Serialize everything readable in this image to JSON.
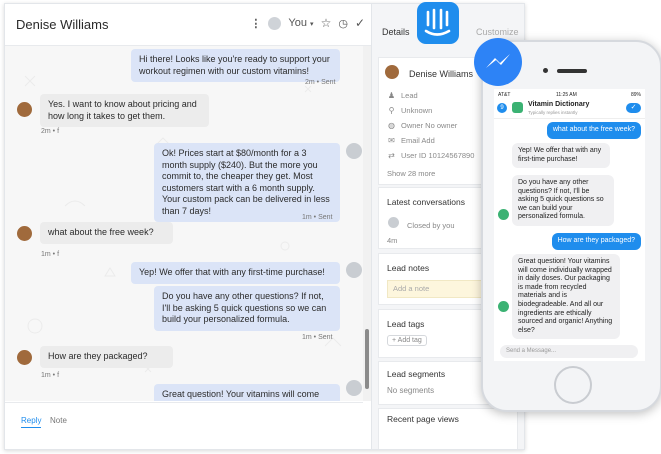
{
  "conversation": {
    "contact_name": "Denise Williams",
    "assignee": "You",
    "messages": [
      {
        "from": "admin",
        "text": "Hi there! Looks like you're ready to support your workout regimen with our custom vitamins!",
        "meta": "2m • Sent"
      },
      {
        "from": "user",
        "text": "Yes. I want to know about pricing and how long it takes to get them.",
        "meta": "2m • f"
      },
      {
        "from": "admin",
        "text": "Ok! Prices start at $80/month for a 3 month supply ($240). But the more you commit to, the cheaper they get. Most customers start with a 6 month supply. Your custom pack can be delivered in less than 7 days!",
        "meta": "1m • Sent"
      },
      {
        "from": "user",
        "text": "what about the free week?",
        "meta": "1m • f"
      },
      {
        "from": "admin",
        "text": "Yep! We offer that with any first-time purchase!"
      },
      {
        "from": "admin",
        "text": "Do you have any other questions? If not, I'll be asking 5 quick questions so we can build your personalized formula.",
        "meta": "1m • Sent"
      },
      {
        "from": "user",
        "text": "How are they packaged?",
        "meta": "1m • f"
      },
      {
        "from": "admin",
        "text": "Great question! Your vitamins will come individually wrapped in daily doses. Our"
      }
    ],
    "reply_tabs": [
      "Reply",
      "Note"
    ]
  },
  "sidebar": {
    "tabs": [
      "Details",
      "Customize"
    ],
    "contact_name": "Denise Williams",
    "fields": [
      {
        "icon": "person-icon",
        "text": "Lead"
      },
      {
        "icon": "location-icon",
        "text": "Unknown"
      },
      {
        "icon": "owner-icon",
        "text": "Owner   No owner"
      },
      {
        "icon": "email-icon",
        "text": "Email   Add"
      },
      {
        "icon": "userid-icon",
        "text": "User ID   10124567890"
      }
    ],
    "show_more": "Show 28 more",
    "latest_conversations": {
      "title": "Latest conversations",
      "status": "Closed by you",
      "time": "4m"
    },
    "lead_notes": {
      "title": "Lead notes",
      "placeholder": "Add a note"
    },
    "lead_tags": {
      "title": "Lead tags",
      "button": "+ Add tag"
    },
    "lead_segments": {
      "title": "Lead segments",
      "value": "No segments"
    },
    "recent_page_views": {
      "title": "Recent page views"
    }
  },
  "phone": {
    "status": {
      "carrier": "AT&T",
      "time": "11:25 AM",
      "battery": "89%"
    },
    "app_title": "Vitamin Dictionary",
    "app_subtitle": "Typically replies instantly",
    "back_count": "9",
    "messages": [
      {
        "side": "right",
        "text": "what about the free week?"
      },
      {
        "side": "left",
        "text": "Yep! We offer that with any first-time purchase!"
      },
      {
        "side": "left",
        "text": "Do you have any other questions? If not, I'll be asking 5 quick questions so we can build your personalized formula."
      },
      {
        "side": "right",
        "text": "How are they packaged?"
      },
      {
        "side": "left",
        "text": "Great question! Your vitamins will come individually wrapped in daily doses. Our packaging is made from recycled materials and is biodegradeable. And all our ingredients are ethically sourced and organic! Anything else?"
      }
    ],
    "composer_placeholder": "Send a Message..."
  },
  "colors": {
    "brand_blue": "#1f8ded",
    "admin_bubble": "#dbe4f7",
    "user_bubble": "#ececec",
    "messenger_blue": "#2d83f6"
  }
}
